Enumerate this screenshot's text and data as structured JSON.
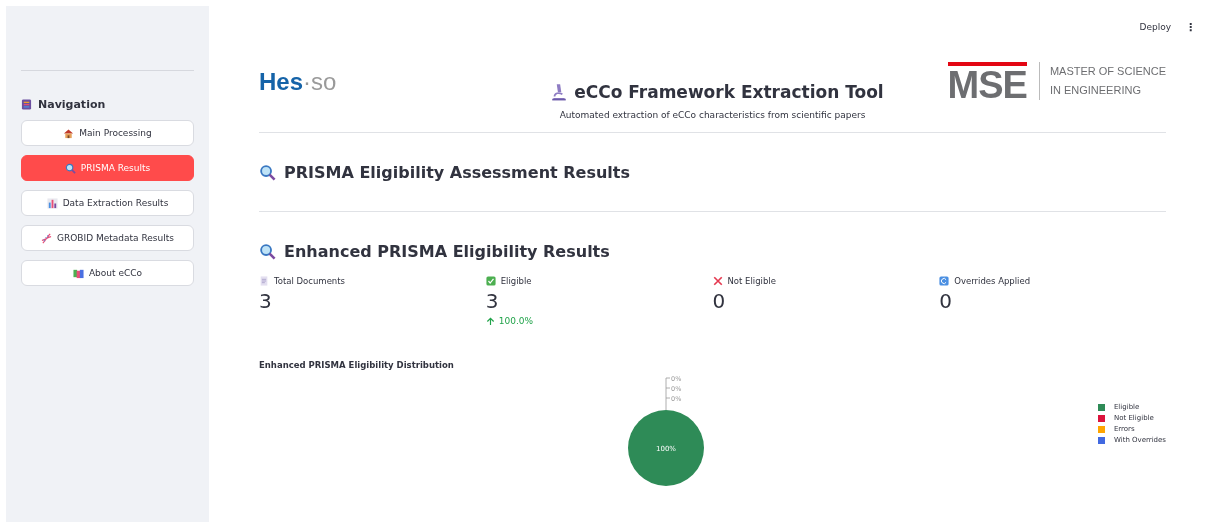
{
  "toolbar": {
    "deploy": "Deploy",
    "menu": "⋮"
  },
  "sidebar": {
    "title": "Navigation",
    "items": [
      {
        "label": "Main Processing",
        "selected": false
      },
      {
        "label": "PRISMA Results",
        "selected": true
      },
      {
        "label": "Data Extraction Results",
        "selected": false
      },
      {
        "label": "GROBID Metadata Results",
        "selected": false
      },
      {
        "label": "About eCCo",
        "selected": false
      }
    ]
  },
  "header": {
    "left_logo": {
      "primary": "Hes",
      "secondary": "·so"
    },
    "title": "eCCo Framework Extraction Tool",
    "subtitle": "Automated extraction of eCCo characteristics from scientific papers",
    "right_logo": {
      "mark": "MSE",
      "line_1": "MASTER OF SCIENCE",
      "line_2": "IN ENGINEERING"
    }
  },
  "section_heading": "PRISMA Eligibility Assessment Results",
  "results_heading": "Enhanced PRISMA Eligibility Results",
  "metrics": [
    {
      "label": "Total Documents",
      "value": "3"
    },
    {
      "label": "Eligible",
      "value": "3",
      "delta": "100.0%"
    },
    {
      "label": "Not Eligible",
      "value": "0"
    },
    {
      "label": "Overrides Applied",
      "value": "0"
    }
  ],
  "chart": {
    "chart_data": {
      "type": "pie",
      "title": "Enhanced PRISMA Eligibility Distribution",
      "categories": [
        "Eligible",
        "Not Eligible",
        "Errors",
        "With Overrides"
      ],
      "values": [
        100,
        0,
        0,
        0
      ],
      "value_labels": [
        "100%",
        "0%",
        "0%",
        "0%"
      ]
    },
    "legend": [
      {
        "color": "#2e8b57"
      },
      {
        "color": "#dc143c"
      },
      {
        "color": "#ffa500"
      },
      {
        "color": "#4169e1"
      }
    ]
  }
}
